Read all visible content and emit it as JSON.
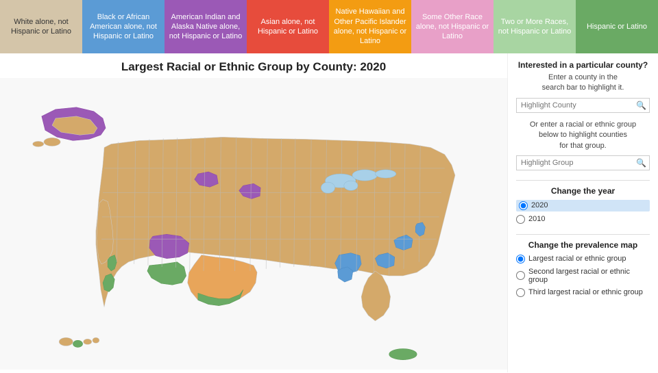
{
  "legend": {
    "items": [
      {
        "id": "white",
        "label": "White alone,\nnot Hispanic or Latino",
        "bg": "#d4c5a9",
        "textDark": true
      },
      {
        "id": "black",
        "label": "Black or\nAfrican American\nalone,\nnot Hispanic or Latino",
        "bg": "#5b9bd5",
        "textDark": false
      },
      {
        "id": "american-indian",
        "label": "American Indian and\nAlaska Native alone,\nnot Hispanic or Latino",
        "bg": "#9b59b6",
        "textDark": false
      },
      {
        "id": "asian",
        "label": "Asian alone,\nnot Hispanic or Latino",
        "bg": "#e74c3c",
        "textDark": false
      },
      {
        "id": "native-hawaiian",
        "label": "Native Hawaiian and\nOther Pacific Islander\nalone,\nnot Hispanic or Latino",
        "bg": "#f39c12",
        "textDark": false
      },
      {
        "id": "other-race",
        "label": "Some Other Race\nalone,\nnot Hispanic or Latino",
        "bg": "#e8a0c8",
        "textDark": false
      },
      {
        "id": "two-or-more",
        "label": "Two or More Races,\nnot Hispanic or Latino",
        "bg": "#a8d5a2",
        "textDark": false
      },
      {
        "id": "hispanic",
        "label": "Hispanic or Latino",
        "bg": "#6aaa64",
        "textDark": false
      }
    ]
  },
  "title": "Largest Racial or Ethnic Group by County: 2020",
  "sidebar": {
    "county_section_title": "Interested in a particular county?",
    "county_desc": "Enter a county in the\nsearch bar to highlight it.",
    "county_placeholder": "Highlight County",
    "group_desc": "Or enter a racial or ethnic group\nbelow to highlight counties\nfor that group.",
    "group_placeholder": "Highlight Group",
    "year_section_title": "Change the year",
    "year_options": [
      "2020",
      "2010"
    ],
    "year_selected": "2020",
    "map_section_title": "Change the prevalence map",
    "map_options": [
      "Largest racial or ethnic group",
      "Second largest racial or ethnic group",
      "Third largest racial or ethnic group"
    ],
    "map_selected": "Largest racial or ethnic group"
  }
}
